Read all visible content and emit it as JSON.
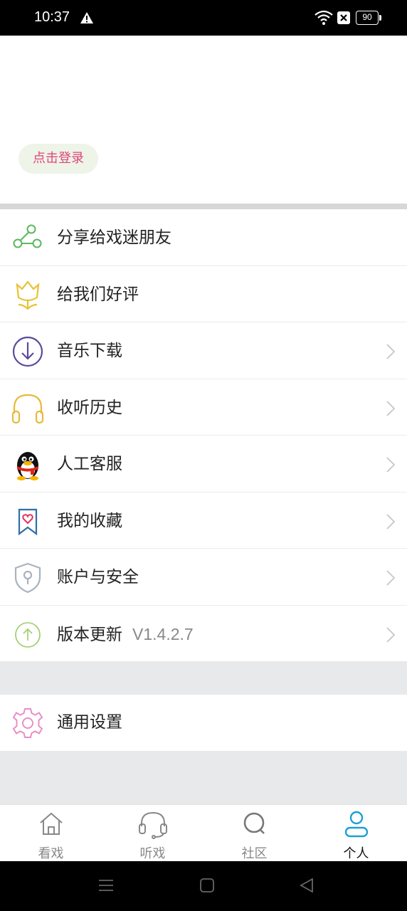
{
  "status_bar": {
    "time": "10:37",
    "battery_level": "90",
    "icons": [
      "warning-icon",
      "wifi-icon",
      "sim-blocked-icon",
      "battery-icon"
    ]
  },
  "header": {
    "login_label": "点击登录",
    "login_color": "#e0457b"
  },
  "menu": {
    "items": [
      {
        "label": "分享给戏迷朋友",
        "icon": "share-icon",
        "chevron": false
      },
      {
        "label": "给我们好评",
        "icon": "flower-icon",
        "chevron": false
      },
      {
        "label": "音乐下载",
        "icon": "download-icon",
        "chevron": true
      },
      {
        "label": "收听历史",
        "icon": "headphones-icon",
        "chevron": true
      },
      {
        "label": "人工客服",
        "icon": "qq-penguin-icon",
        "chevron": true
      },
      {
        "label": "我的收藏",
        "icon": "bookmark-heart-icon",
        "chevron": true
      },
      {
        "label": "账户与安全",
        "icon": "shield-lock-icon",
        "chevron": true
      },
      {
        "label": "版本更新",
        "extra": "V1.4.2.7",
        "icon": "upgrade-icon",
        "chevron": true
      }
    ]
  },
  "settings": {
    "label": "通用设置",
    "icon": "gear-icon"
  },
  "tabs": [
    {
      "label": "看戏",
      "icon": "home-icon",
      "active": false
    },
    {
      "label": "听戏",
      "icon": "headset-icon",
      "active": false
    },
    {
      "label": "社区",
      "icon": "search-icon",
      "active": false
    },
    {
      "label": "个人",
      "icon": "person-icon",
      "active": true
    }
  ],
  "colors": {
    "accent": "#1e9fd6",
    "share": "#5cb85c",
    "flower": "#e8c234",
    "download": "#5b4a9b",
    "headphones": "#e8b93a",
    "bookmark": "#2f6fa8",
    "shield": "#a8b4bf",
    "upgrade": "#9ccc65",
    "gear": "#e98fc6"
  }
}
